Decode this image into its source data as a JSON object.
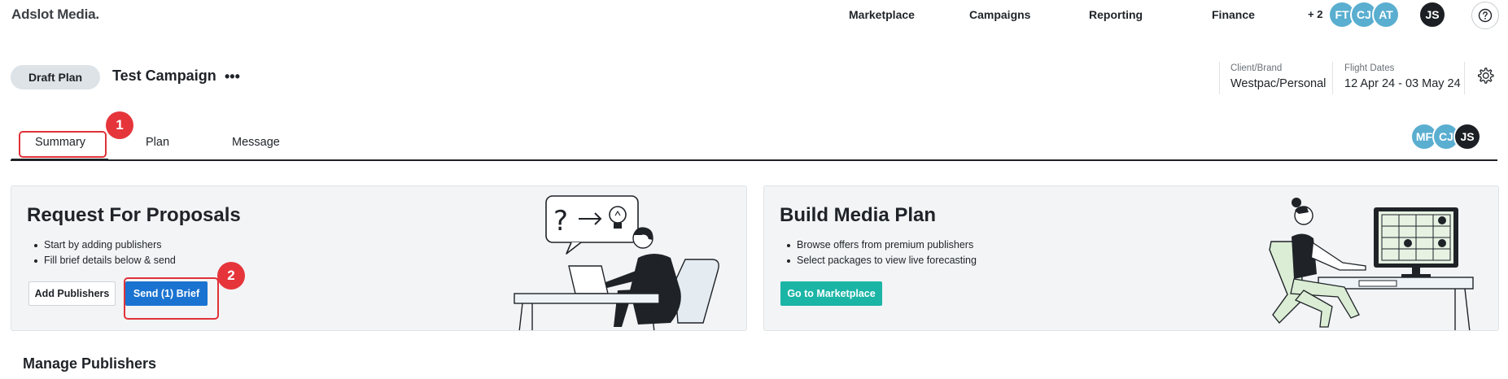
{
  "app": {
    "logo": "Adslot Media."
  },
  "nav": {
    "links": [
      "Marketplace",
      "Campaigns",
      "Reporting",
      "Finance"
    ],
    "overflow_count": "+ 2",
    "team_avatars": [
      "FT",
      "CJ",
      "AT"
    ],
    "user_avatar": "JS",
    "help_icon": "question-circle-icon"
  },
  "plan": {
    "status_pill": "Draft Plan",
    "campaign_name": "Test Campaign",
    "more_label": "•••",
    "client_brand_label": "Client/Brand",
    "client_brand_value": "Westpac/Personal",
    "flight_dates_label": "Flight Dates",
    "flight_dates_value": "12 Apr 24 - 03 May 24",
    "settings_icon": "gear-icon"
  },
  "tabs": {
    "items": [
      "Summary",
      "Plan",
      "Message"
    ],
    "active": "Summary",
    "collaborators": [
      "MF",
      "CJ",
      "JS"
    ]
  },
  "callouts": [
    "1",
    "2"
  ],
  "rfp_card": {
    "title": "Request For Proposals",
    "bullets": [
      "Start by adding publishers",
      "Fill brief details below & send"
    ],
    "add_publishers_label": "Add Publishers",
    "send_brief_label": "Send (1) Brief"
  },
  "build_card": {
    "title": "Build Media Plan",
    "bullets": [
      "Browse offers from premium publishers",
      "Select packages to view live forecasting"
    ],
    "marketplace_label": "Go to Marketplace"
  },
  "manage": {
    "title": "Manage Publishers"
  },
  "colors": {
    "accent_blue": "#1a73d0",
    "accent_teal": "#1bb5a6",
    "callout_red": "#e5353b",
    "avatar_teal": "#5aaed0"
  }
}
